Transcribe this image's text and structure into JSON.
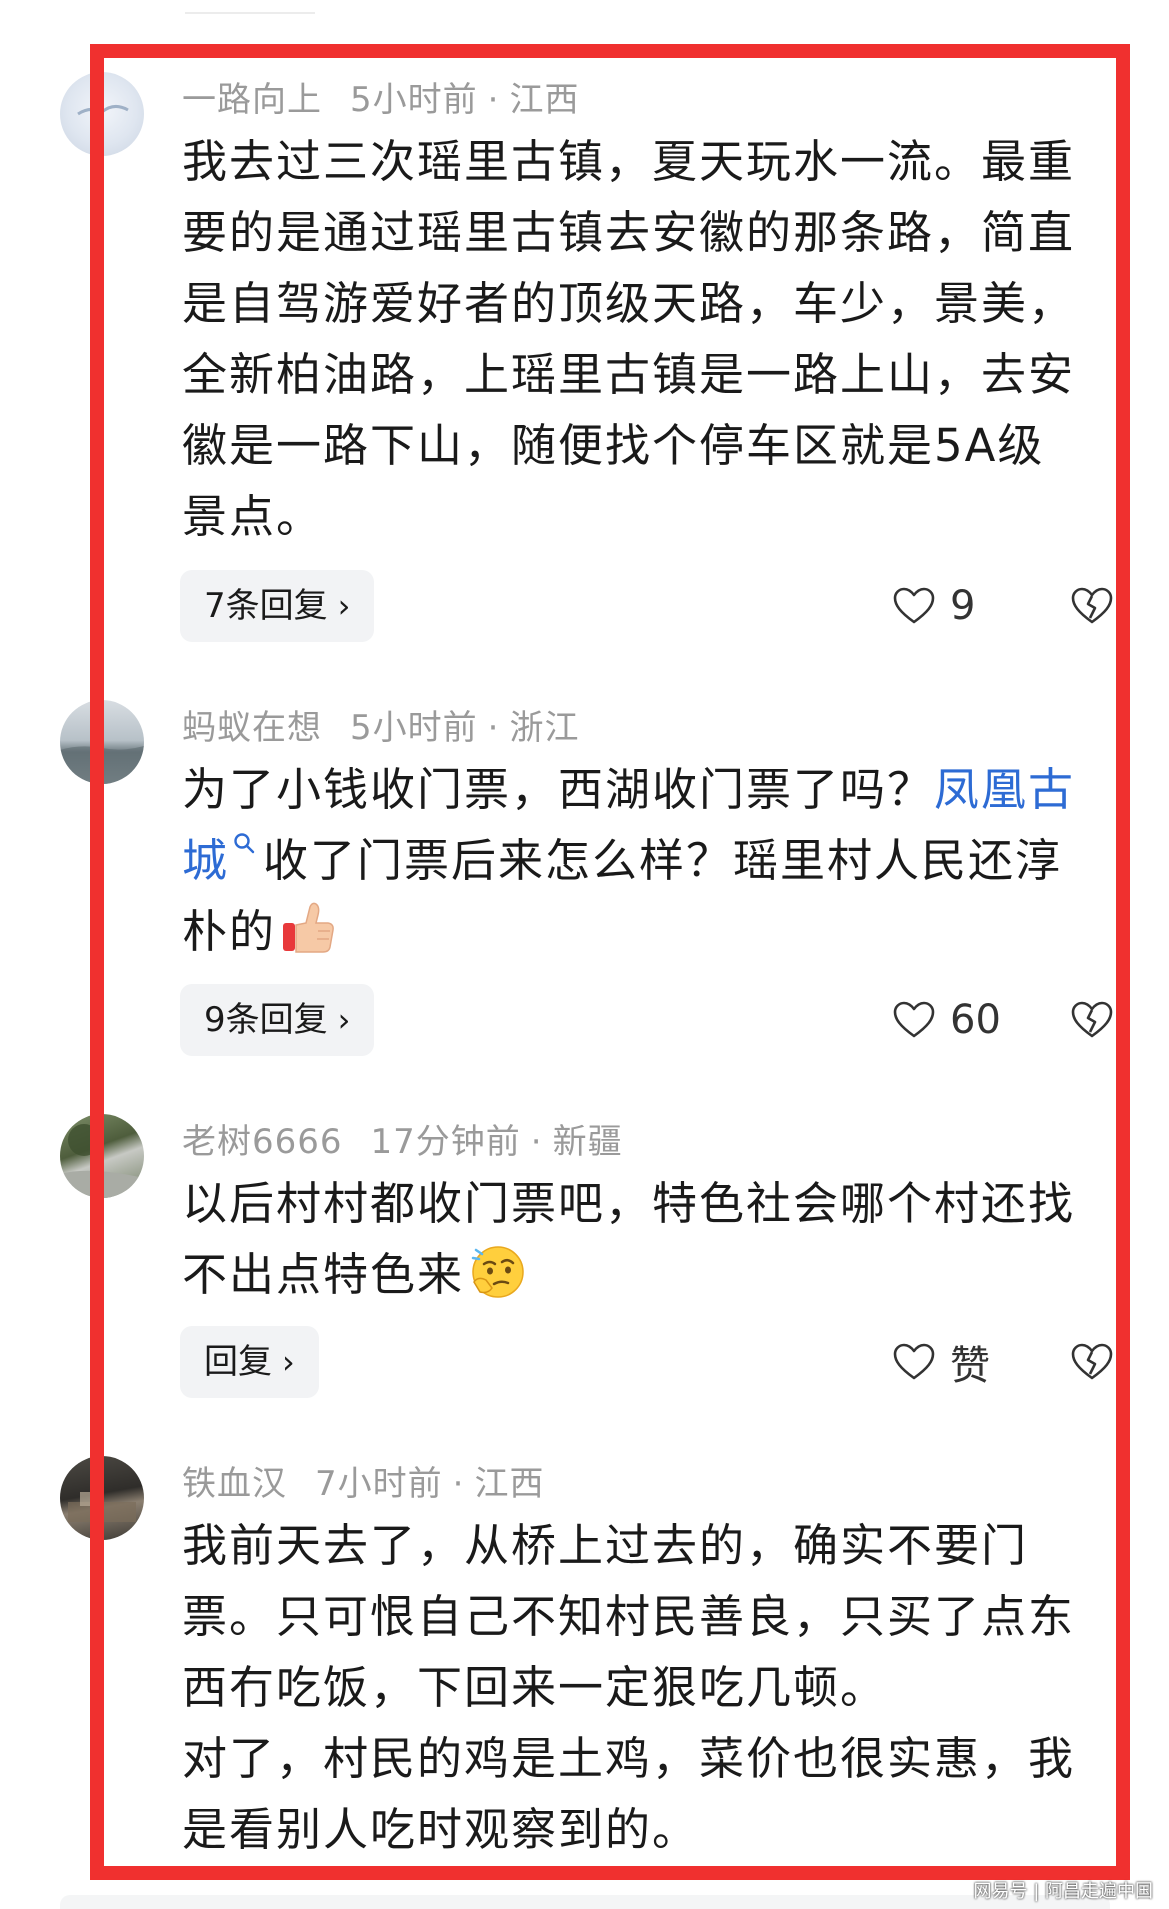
{
  "comments": [
    {
      "user": "一路向上",
      "time": "5小时前",
      "separator": "·",
      "location": "江西",
      "text_lines": [
        "我去过三次瑶里古镇，夏天玩水一流。最重",
        "要的是通过瑶里古镇去安徽的那条路，简直",
        "是自驾游爱好者的顶级天路，车少，景美，",
        "全新柏油路，上瑶里古镇是一路上山，去安",
        "徽是一路下山，随便找个停车区就是5A级",
        "景点。"
      ],
      "reply_label": "7条回复",
      "likes": "9"
    },
    {
      "user": "蚂蚁在想",
      "time": "5小时前",
      "separator": "·",
      "location": "浙江",
      "text_before": "为了小钱收门票，西湖收门票了吗？",
      "link_part1": "凤凰古",
      "link_part2": "城",
      "text_after_line2": "收了门票后来怎么样？瑶里村人民还淳",
      "text_line3": "朴的",
      "emoji": "thumbs-up",
      "reply_label": "9条回复",
      "likes": "60"
    },
    {
      "user": "老树6666",
      "time": "17分钟前",
      "separator": "·",
      "location": "新疆",
      "text_line1": "以后村村都收门票吧，特色社会哪个村还找",
      "text_line2": "不出点特色来",
      "emoji": "thinking-face",
      "reply_label": "回复",
      "likes": "赞"
    },
    {
      "user": "铁血汉",
      "time": "7小时前",
      "separator": "·",
      "location": "江西",
      "text_lines": [
        "我前天去了，从桥上过去的，确实不要门",
        "票。只可恨自己不知村民善良，只买了点东",
        "西冇吃饭，下回来一定狠吃几顿。",
        "对了，村民的鸡是土鸡，菜价也很实惠，我",
        "是看别人吃时观察到的。"
      ]
    }
  ],
  "icons": {
    "like": "heart-outline-icon",
    "dislike": "broken-heart-icon",
    "reply_chevron": "chevron-right-icon",
    "link_search": "search-icon"
  },
  "chevron": "›",
  "watermark": "网易号 | 阿昌走遍中国",
  "colors": {
    "highlight_border": "#f0302f",
    "link": "#2d6bd4",
    "meta": "#9a9a9a",
    "reply_bg": "#f2f3f5"
  }
}
